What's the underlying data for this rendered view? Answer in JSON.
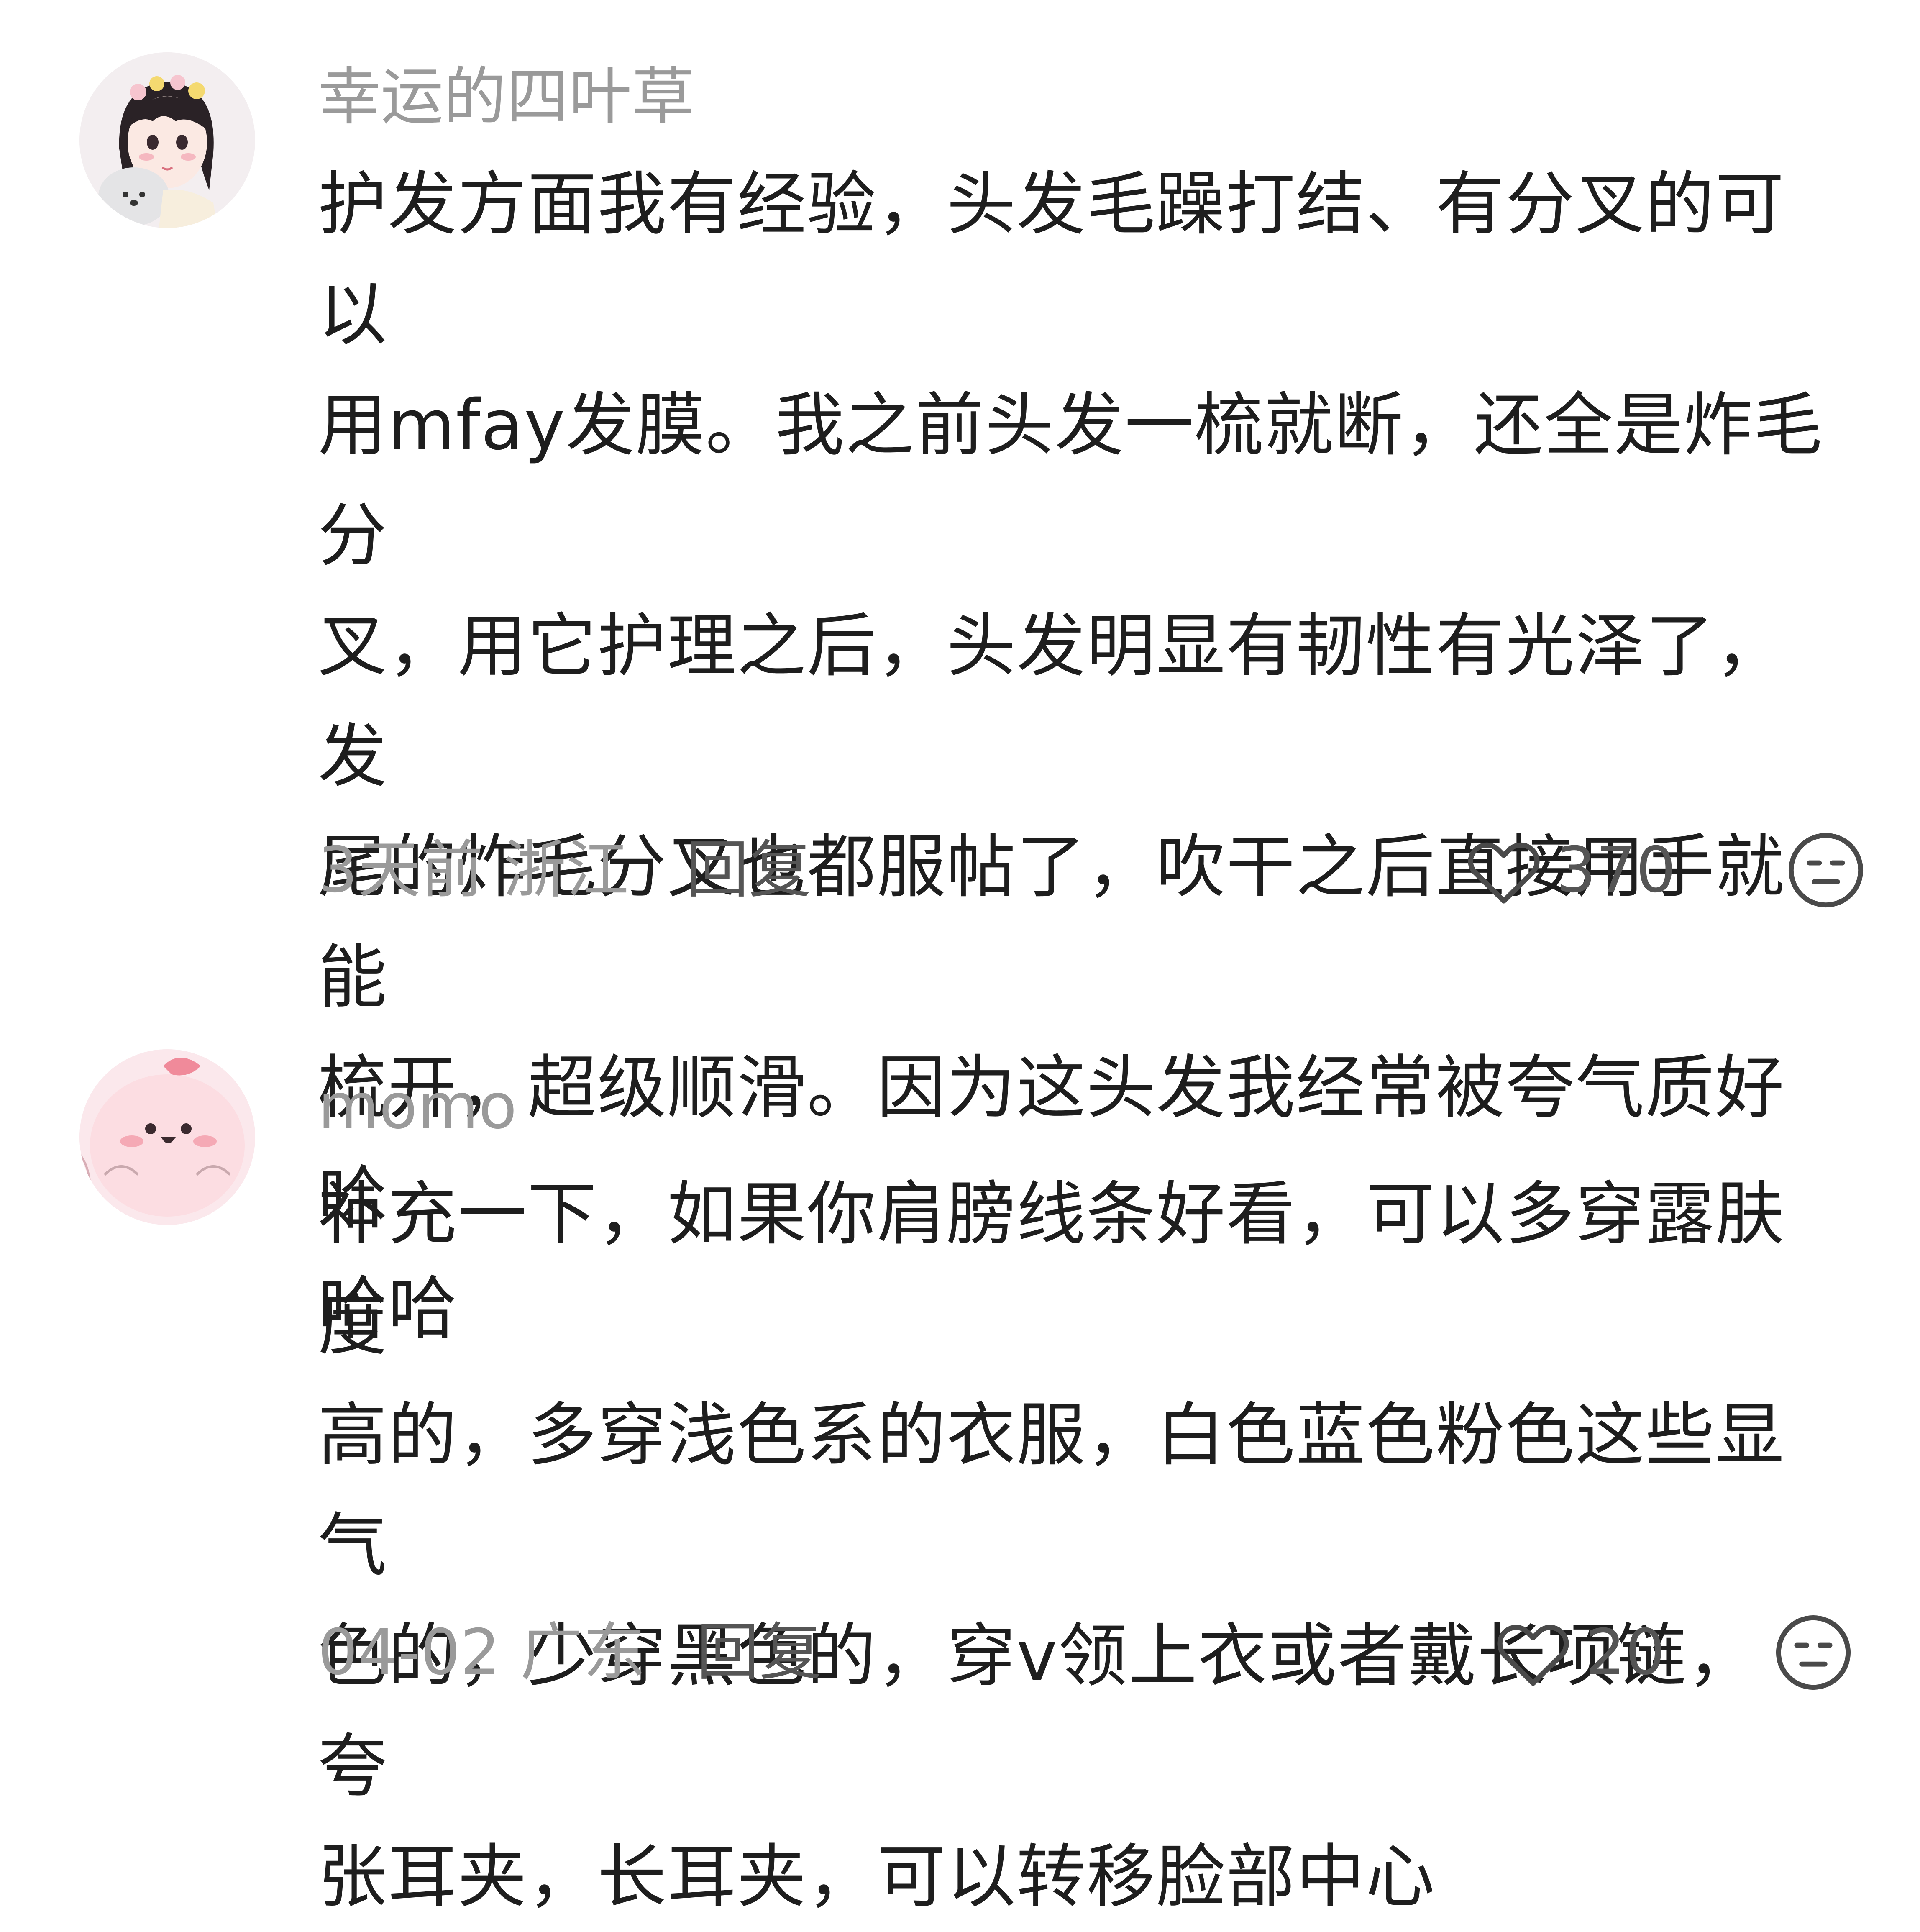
{
  "comments": [
    {
      "username": "幸运的四叶草",
      "avatar_icon": "girl-with-dog-avatar",
      "lines": [
        "护发方面我有经验，头发毛躁打结、有分叉的可以",
        "用mfay发膜。我之前头发一梳就断，还全是炸毛分",
        "叉，用它护理之后，头发明显有韧性有光泽了，发",
        "尾的炸毛分叉也都服帖了，吹干之后直接用手就能",
        "梳开，超级顺滑。因为这头发我经常被夸气质好哈",
        "哈哈"
      ],
      "time_location": "3天前 浙江",
      "reply_label": "回复",
      "like_count": "370",
      "like_icon": "heart-outline-icon",
      "dislike_icon": "neutral-face-icon"
    },
    {
      "username": "momo",
      "avatar_icon": "pink-cartoon-avatar",
      "lines": [
        "补充一下，如果你肩膀线条好看，可以多穿露肤度",
        "高的，多穿浅色系的衣服，白色蓝色粉色这些显气",
        "色的，少穿黑色的，穿v领上衣或者戴长项链，夸",
        "张耳夹，长耳夹，可以转移脸部中心"
      ],
      "time_location": "04-02 广东",
      "reply_label": "回复",
      "like_count": "20",
      "like_icon": "heart-outline-icon",
      "dislike_icon": "neutral-face-icon"
    }
  ],
  "colors": {
    "username": "#9a9a9a",
    "body": "#1e1e1e",
    "meta": "#9a9a9a",
    "action": "#555555"
  }
}
